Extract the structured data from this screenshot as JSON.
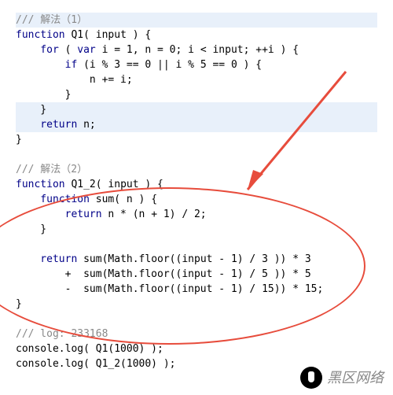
{
  "code": {
    "c1": "/// 解法（1）",
    "l2a": "function",
    "l2b": " Q1( input ) {",
    "l3a": "    for",
    "l3b": " ( ",
    "l3c": "var",
    "l3d": " i = 1, n = 0; i < input; ++i ) {",
    "l4a": "        if",
    "l4b": " (i % 3 == 0 || i % 5 == 0 ) {",
    "l5": "            n += i;",
    "l6": "        }",
    "l7": "    }",
    "l8a": "    return",
    "l8b": " n;",
    "l9": "}",
    "blank1": " ",
    "c2": "/// 解法（2）",
    "l12a": "function",
    "l12b": " Q1_2( input ) {",
    "l13a": "    function",
    "l13b": " sum( n ) {",
    "l14a": "        return",
    "l14b": " n * (n + 1) / 2;",
    "l15": "    }",
    "blank2": " ",
    "l17a": "    return",
    "l17b": " sum(Math.floor((input - 1) / 3 )) * 3",
    "l18": "        +  sum(Math.floor((input - 1) / 5 )) * 5",
    "l19": "        -  sum(Math.floor((input - 1) / 15)) * 15;",
    "l20": "}",
    "blank3": " ",
    "c3": "/// log: 233168",
    "l22": "console.log( Q1(1000) );",
    "l23": "console.log( Q1_2(1000) );"
  },
  "watermark_text": "黑区网络"
}
